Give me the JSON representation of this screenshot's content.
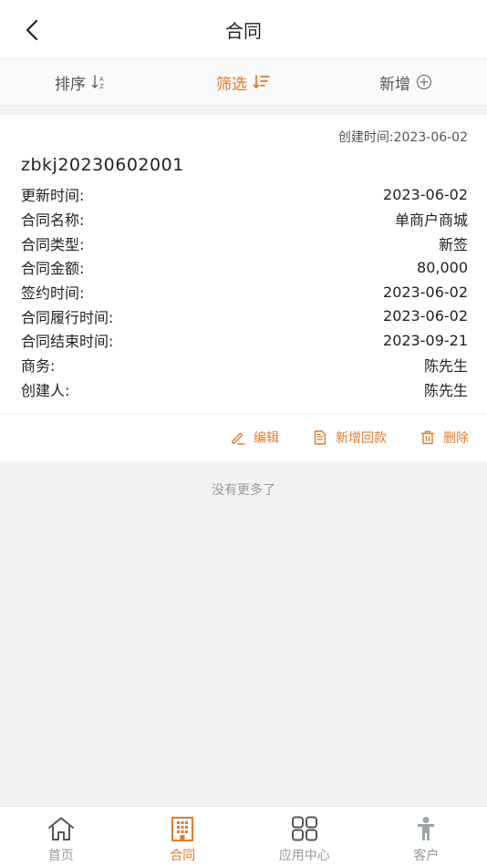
{
  "header": {
    "title": "合同"
  },
  "toolbar": {
    "sort_label": "排序",
    "filter_label": "筛选",
    "add_label": "新增"
  },
  "card": {
    "created_text": "创建时间:2023-06-02",
    "contract_no": "zbkj20230602001",
    "rows": [
      {
        "label": "更新时间:",
        "value": "2023-06-02"
      },
      {
        "label": "合同名称:",
        "value": "单商户商城"
      },
      {
        "label": "合同类型:",
        "value": "新签"
      },
      {
        "label": "合同金额:",
        "value": "80,000"
      },
      {
        "label": "签约时间:",
        "value": "2023-06-02"
      },
      {
        "label": "合同履行时间:",
        "value": "2023-06-02"
      },
      {
        "label": "合同结束时间:",
        "value": "2023-09-21"
      },
      {
        "label": "商务:",
        "value": "陈先生"
      },
      {
        "label": "创建人:",
        "value": "陈先生"
      }
    ],
    "actions": {
      "edit_label": "编辑",
      "add_payment_label": "新增回款",
      "delete_label": "删除"
    }
  },
  "list": {
    "no_more_text": "没有更多了"
  },
  "tabbar": {
    "items": [
      {
        "label": "首页",
        "icon": "home-icon"
      },
      {
        "label": "合同",
        "icon": "building-icon"
      },
      {
        "label": "应用中心",
        "icon": "grid-icon"
      },
      {
        "label": "客户",
        "icon": "person-icon"
      }
    ],
    "active_index": 1
  },
  "colors": {
    "accent": "#e07a2e",
    "muted": "#999999"
  }
}
